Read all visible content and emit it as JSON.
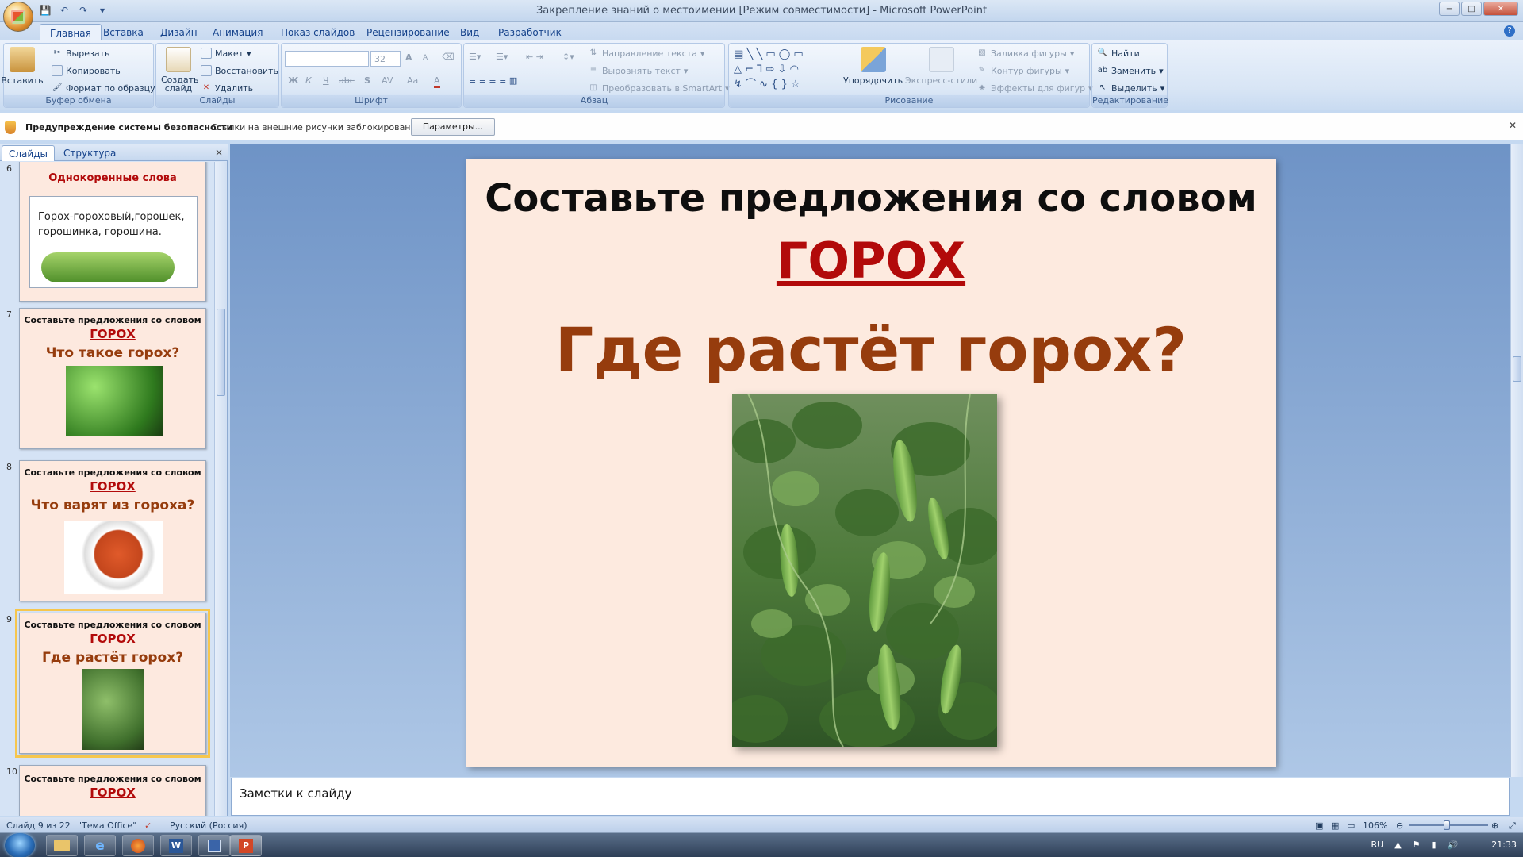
{
  "window": {
    "title": "Закрепление знаний о местоимении [Режим совместимости] - Microsoft PowerPoint",
    "minimize": "−",
    "maximize": "□",
    "close": "✕"
  },
  "ribbon_tabs": [
    "Главная",
    "Вставка",
    "Дизайн",
    "Анимация",
    "Показ слайдов",
    "Рецензирование",
    "Вид",
    "Разработчик"
  ],
  "help": "?",
  "clipboard": {
    "label": "Буфер обмена",
    "paste": "Вставить",
    "cut": "Вырезать",
    "copy": "Копировать",
    "format_painter": "Формат по образцу"
  },
  "slides_group": {
    "label": "Слайды",
    "new_slide": "Создать слайд",
    "layout": "Макет",
    "reset": "Восстановить",
    "delete": "Удалить"
  },
  "font_group": {
    "label": "Шрифт",
    "font_name": "",
    "font_size": "32",
    "bold": "Ж",
    "italic": "К",
    "underline": "Ч",
    "strike": "abc",
    "shadow": "S",
    "spacing": "AV",
    "case": "Aa",
    "grow": "A",
    "shrink": "A",
    "color": "A"
  },
  "paragraph_group": {
    "label": "Абзац",
    "text_direction": "Направление текста",
    "align_text": "Выровнять текст",
    "smartart": "Преобразовать в SmartArt"
  },
  "drawing_group": {
    "label": "Рисование",
    "arrange": "Упорядочить",
    "quick_styles": "Экспресс-стили",
    "shape_fill": "Заливка фигуры",
    "shape_outline": "Контур фигуры",
    "shape_effects": "Эффекты для фигур"
  },
  "editing_group": {
    "label": "Редактирование",
    "find": "Найти",
    "replace": "Заменить",
    "select": "Выделить"
  },
  "security_bar": {
    "title": "Предупреждение системы безопасности",
    "message": "Ссылки на внешние рисунки заблокированы",
    "options_button": "Параметры..."
  },
  "left_pane": {
    "tabs": [
      "Слайды",
      "Структура"
    ],
    "close": "×",
    "thumbnails": [
      {
        "num": "6",
        "title": "Однокоренные слова",
        "text": "Горох-гороховый,горошек, горошинка, горошина."
      },
      {
        "num": "7",
        "title": "Составьте предложения со словом",
        "word": "ГОРОХ",
        "question": "Что такое горох?"
      },
      {
        "num": "8",
        "title": "Составьте предложения со словом",
        "word": "ГОРОХ",
        "question": "Что варят из гороха?"
      },
      {
        "num": "9",
        "title": "Составьте предложения со словом",
        "word": "ГОРОХ",
        "question": "Где растёт горох?"
      },
      {
        "num": "10",
        "title": "Составьте предложения со словом",
        "word": "ГОРОХ"
      }
    ]
  },
  "slide": {
    "title": "Составьте предложения со словом",
    "word": "ГОРОХ",
    "question": "Где растёт горох?"
  },
  "notes": {
    "placeholder": "Заметки к слайду"
  },
  "status": {
    "slide_counter": "Слайд 9 из 22",
    "theme": "\"Тема Office\"",
    "language": "Русский (Россия)",
    "zoom": "106%"
  },
  "taskbar": {
    "lang": "RU",
    "time": "21:33"
  }
}
